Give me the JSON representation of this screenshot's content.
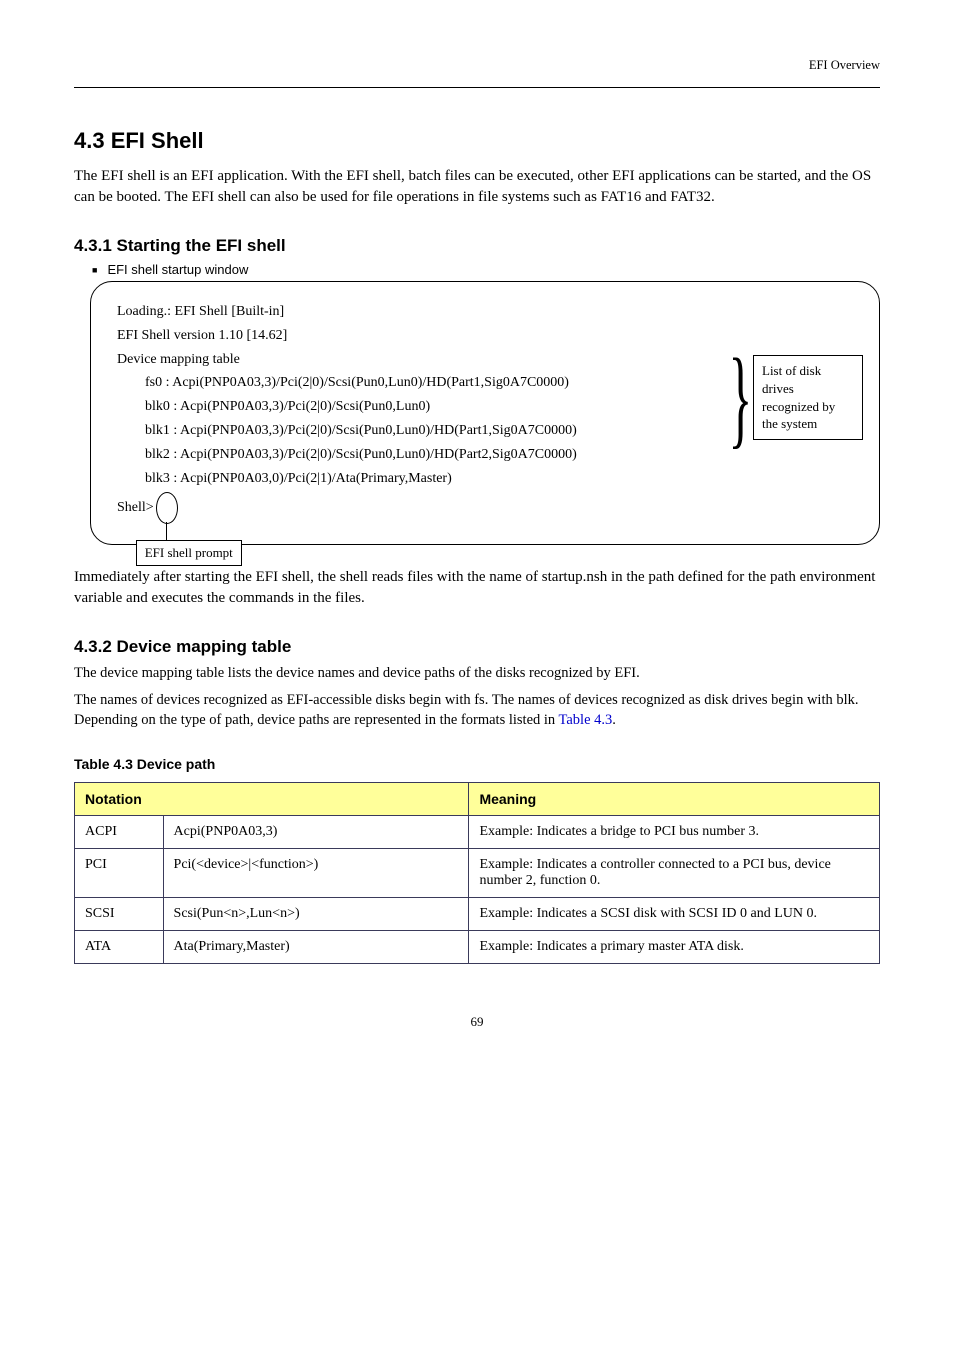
{
  "header": {
    "right": "EFI Overview"
  },
  "title": "4.3  EFI Shell",
  "intro": "The EFI shell is an EFI application.  With the EFI shell, batch files can be executed, other EFI applications can be started, and the OS can be booted.  The EFI shell can also be used for file operations in file systems such as FAT16 and FAT32.",
  "start_heading": "4.3.1  Starting the EFI shell",
  "start_bullet": "EFI shell startup window",
  "console": {
    "l1": "Loading.: EFI Shell [Built-in]",
    "l2": "EFI Shell version 1.10 [14.62]",
    "l3": "Device mapping table",
    "l4": "fs0   : Acpi(PNP0A03,3)/Pci(2|0)/Scsi(Pun0,Lun0)/HD(Part1,Sig0A7C0000)",
    "l5": "blk0 : Acpi(PNP0A03,3)/Pci(2|0)/Scsi(Pun0,Lun0)",
    "l6": "blk1 : Acpi(PNP0A03,3)/Pci(2|0)/Scsi(Pun0,Lun0)/HD(Part1,Sig0A7C0000)",
    "l7": "blk2 : Acpi(PNP0A03,3)/Pci(2|0)/Scsi(Pun0,Lun0)/HD(Part2,Sig0A7C0000)",
    "l8": "blk3 : Acpi(PNP0A03,0)/Pci(2|1)/Ata(Primary,Master)",
    "shell": "Shell>"
  },
  "prompt_label": "EFI shell prompt",
  "brace_annot": "List of disk drives recognized by the system",
  "after_console": "Immediately after starting the EFI shell, the shell reads files with the name of startup.nsh in the path defined for the path environment variable and executes the commands in the files.",
  "devmap": {
    "heading": "4.3.2  Device mapping table",
    "desc": "The device mapping table lists the device names and device paths of the disks recognized by EFI.",
    "desc2_a": "The names of devices recognized as EFI-accessible disks begin with fs.  The names of devices recognized as disk drives begin with blk.  Depending on the type of path, device paths are represented in the formats listed in ",
    "desc2_tableref": "Table 4.3",
    "desc2_b": ".",
    "table_caption": "Table 4.3  Device path",
    "headers": {
      "notation": "Notation",
      "meaning": "Meaning"
    },
    "rows": [
      {
        "name": "ACPI",
        "example": "Acpi(PNP0A03,3)",
        "meaning": "Example: Indicates a bridge to PCI bus number 3."
      },
      {
        "name": "PCI",
        "example": "Pci(<device>|<function>)",
        "meaning": "Example: Indicates a controller connected to a PCI bus, device number 2, function 0."
      },
      {
        "name": "SCSI",
        "example": "Scsi(Pun<n>,Lun<n>)",
        "meaning": "Example: Indicates a SCSI disk with SCSI ID 0 and LUN 0."
      },
      {
        "name": "ATA",
        "example": "Ata(Primary,Master)",
        "meaning": "Example: Indicates a primary master ATA disk."
      }
    ]
  },
  "page_number": "69"
}
